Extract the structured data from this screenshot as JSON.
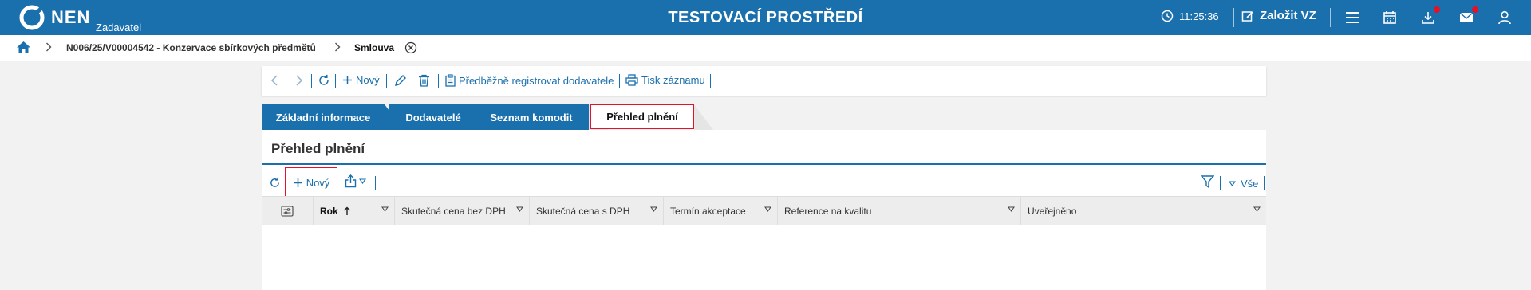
{
  "header": {
    "logo_text": "NEN",
    "logo_subtitle": "Zadavatel",
    "environment_title": "TESTOVACÍ PROSTŘEDÍ",
    "clock": "11:25:36",
    "create_vz_label": "Založit VZ",
    "colors": {
      "bar": "#1a6fad",
      "notification_dot": "#e3112a"
    }
  },
  "breadcrumb": {
    "items": [
      "N006/25/V00004542 - Konzervace sbírkových předmětů",
      "Smlouva"
    ]
  },
  "toolbar": {
    "new_label": "Nový",
    "preregister_label": "Předběžně registrovat dodavatele",
    "print_label": "Tisk záznamu"
  },
  "tabs": [
    {
      "label": "Základní informace"
    },
    {
      "label": "Dodavatelé"
    },
    {
      "label": "Seznam komodit"
    },
    {
      "label": "Přehled plnění",
      "active": true
    }
  ],
  "section": {
    "title": "Přehled plnění",
    "new_label": "Nový",
    "filter_label": "Vše"
  },
  "table": {
    "columns": [
      "Rok",
      "Skutečná cena bez DPH",
      "Skutečná cena s DPH",
      "Termín akceptace",
      "Reference na kvalitu",
      "Uveřejněno"
    ],
    "sorted_column": "Rok",
    "rows": []
  }
}
